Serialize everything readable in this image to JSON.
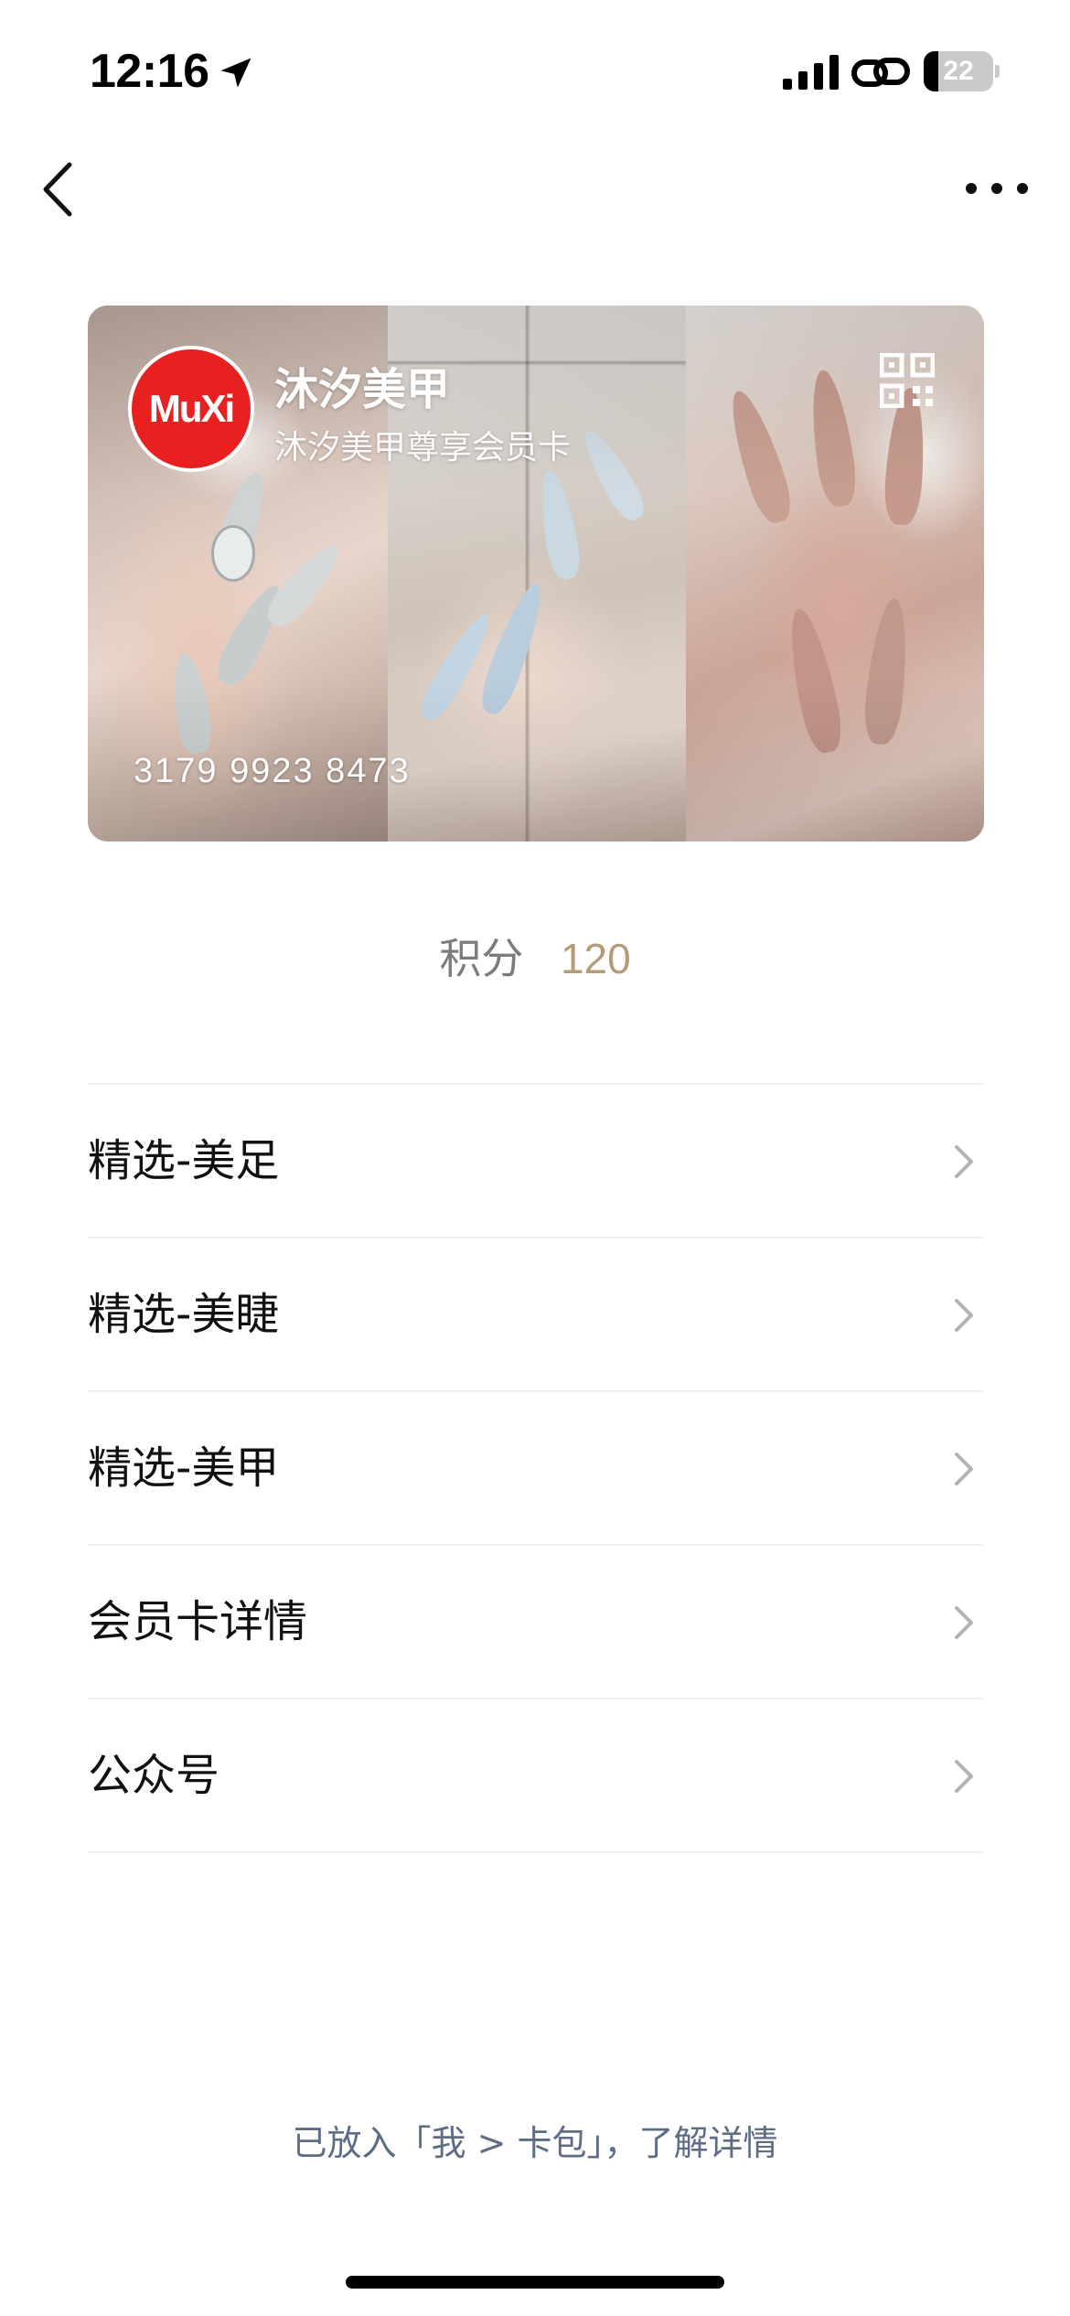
{
  "status_bar": {
    "time": "12:16",
    "battery": "22"
  },
  "card": {
    "logo_text": "MuXi",
    "title": "沐汐美甲",
    "subtitle": "沐汐美甲尊享会员卡",
    "number": "3179 9923 8473",
    "logo_color": "#e8201f"
  },
  "points": {
    "label": "积分",
    "value": "120",
    "value_color": "#b59c79"
  },
  "menu": {
    "items": [
      {
        "label": "精选-美足"
      },
      {
        "label": "精选-美睫"
      },
      {
        "label": "精选-美甲"
      },
      {
        "label": "会员卡详情"
      },
      {
        "label": "公众号"
      }
    ]
  },
  "footer": {
    "link_text": "已放入「我 > 卡包」，了解详情",
    "link_color": "#5e6c85"
  },
  "icons": [
    "location-arrow-icon",
    "signal-icon",
    "link-icon",
    "battery-icon",
    "back-icon",
    "more-icon",
    "qr-code-icon",
    "chevron-right-icon"
  ]
}
